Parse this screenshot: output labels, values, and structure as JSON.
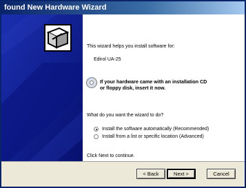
{
  "window": {
    "title": "found New Hardware Wizard"
  },
  "content": {
    "intro": "This wizard helps you install software for:",
    "device": "Edirol UA-25",
    "cd_prompt_line1": "If your hardware came with an installation CD",
    "cd_prompt_line2": "or floppy disk, insert it now.",
    "question": "What do you want the wizard to do?",
    "options": [
      {
        "label": "Install the software automatically (Recommended)",
        "selected": true
      },
      {
        "label": "Install from a list or specific location (Advanced)",
        "selected": false
      }
    ],
    "continue_hint": "Click Next to continue."
  },
  "buttons": {
    "back": "< Back",
    "next": "Next >",
    "cancel": "Cancel"
  },
  "colors": {
    "titlebar": "#0a246a",
    "sidepanel": "#0c1a8f",
    "dialog": "#ece9d8"
  },
  "icons": {
    "wizard": "hardware-box-icon",
    "cd": "cd-disk-icon"
  }
}
